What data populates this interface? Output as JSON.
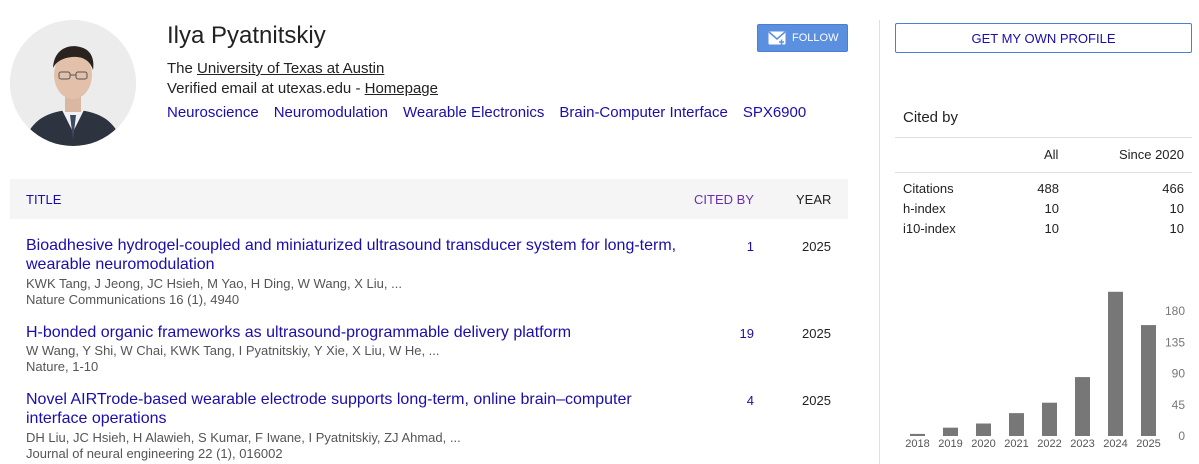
{
  "profile": {
    "name": "Ilya Pyatnitskiy",
    "affiliation_prefix": "The ",
    "affiliation_link": "University of Texas at Austin",
    "email_text": "Verified email at utexas.edu - ",
    "homepage_link": "Homepage",
    "interests": [
      "Neuroscience",
      "Neuromodulation",
      "Wearable Electronics",
      "Brain-Computer Interface",
      "SPX6900"
    ],
    "follow_label": "FOLLOW"
  },
  "table": {
    "headers": {
      "title": "TITLE",
      "cited_by": "CITED BY",
      "year": "YEAR"
    },
    "rows": [
      {
        "title": "Bioadhesive hydrogel-coupled and miniaturized ultrasound transducer system for long-term, wearable neuromodulation",
        "authors": "KWK Tang, J Jeong, JC Hsieh, M Yao, H Ding, W Wang, X Liu, ...",
        "venue": "Nature Communications 16 (1), 4940",
        "cited_by": "1",
        "year": "2025"
      },
      {
        "title": "H-bonded organic frameworks as ultrasound-programmable delivery platform",
        "authors": "W Wang, Y Shi, W Chai, KWK Tang, I Pyatnitskiy, Y Xie, X Liu, W He, ...",
        "venue": "Nature, 1-10",
        "cited_by": "19",
        "year": "2025"
      },
      {
        "title": "Novel AIRTrode-based wearable electrode supports long-term, online brain–computer interface operations",
        "authors": "DH Liu, JC Hsieh, H Alawieh, S Kumar, F Iwane, I Pyatnitskiy, ZJ Ahmad, ...",
        "venue": "Journal of neural engineering 22 (1), 016002",
        "cited_by": "4",
        "year": "2025"
      }
    ]
  },
  "sidebar": {
    "own_profile_label": "GET MY OWN PROFILE",
    "cited_by_title": "Cited by",
    "col_all": "All",
    "col_since": "Since 2020",
    "stats": [
      {
        "label": "Citations",
        "all": "488",
        "since": "466"
      },
      {
        "label": "h-index",
        "all": "10",
        "since": "10"
      },
      {
        "label": "i10-index",
        "all": "10",
        "since": "10"
      }
    ]
  },
  "chart_data": {
    "type": "bar",
    "categories": [
      "2018",
      "2019",
      "2020",
      "2021",
      "2022",
      "2023",
      "2024",
      "2025"
    ],
    "values": [
      3,
      12,
      18,
      33,
      48,
      85,
      208,
      160
    ],
    "yticks": [
      "0",
      "45",
      "90",
      "135",
      "180"
    ],
    "ylim": [
      0,
      225
    ],
    "bar_color": "#777777"
  }
}
